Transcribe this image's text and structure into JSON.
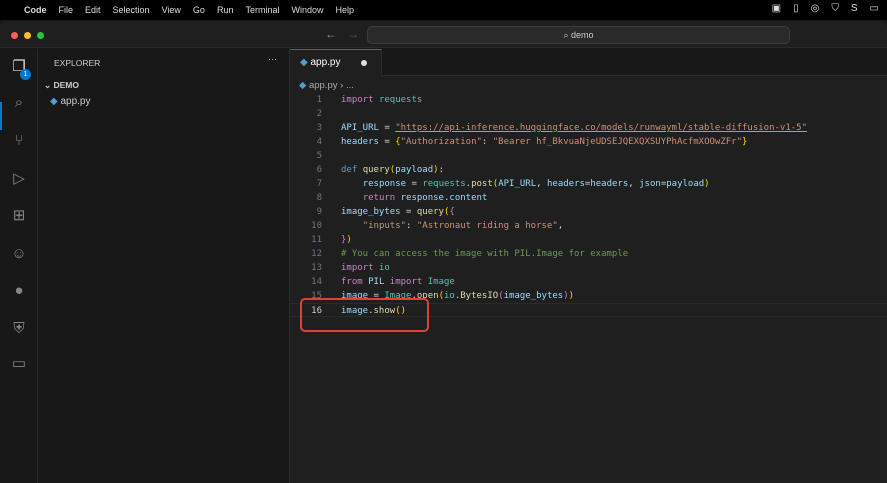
{
  "menubar": {
    "app": "Code",
    "items": [
      "File",
      "Edit",
      "Selection",
      "View",
      "Go",
      "Run",
      "Terminal",
      "Window",
      "Help"
    ]
  },
  "titlebar": {
    "search": "demo",
    "search_icon": "search-icon"
  },
  "activity": {
    "explorer_badge": "1",
    "icons": [
      "files-icon",
      "search-icon",
      "source-control-icon",
      "run-debug-icon",
      "extensions-icon",
      "copilot-icon",
      "github-icon",
      "docker-icon",
      "remote-explorer-icon"
    ]
  },
  "sidebar": {
    "title": "EXPLORER",
    "more": "···",
    "folder": "DEMO",
    "file": "app.py"
  },
  "tab": {
    "label": "app.py",
    "modified": true
  },
  "breadcrumb": {
    "file": "app.py",
    "rest": "..."
  },
  "code": {
    "current_line": 16,
    "lines": [
      "import requests",
      "",
      "API_URL = \"https://api-inference.huggingface.co/models/runwayml/stable-diffusion-v1-5\"",
      "headers = {\"Authorization\": \"Bearer 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\"}",
      "",
      "def query(payload):",
      "    response = requests.post(API_URL, headers=headers, json=payload)",
      "    return response.content",
      "image_bytes = query({",
      "    \"inputs\": \"Astronaut riding a horse\",",
      "})",
      "# You can access the image with PIL.Image for example",
      "import io",
      "from PIL import Image",
      "image = Image.open(io.BytesIO(image_bytes))",
      "image.show()"
    ]
  },
  "colors": {
    "accent": "#0078d4",
    "highlight_box": "#e0403a"
  }
}
